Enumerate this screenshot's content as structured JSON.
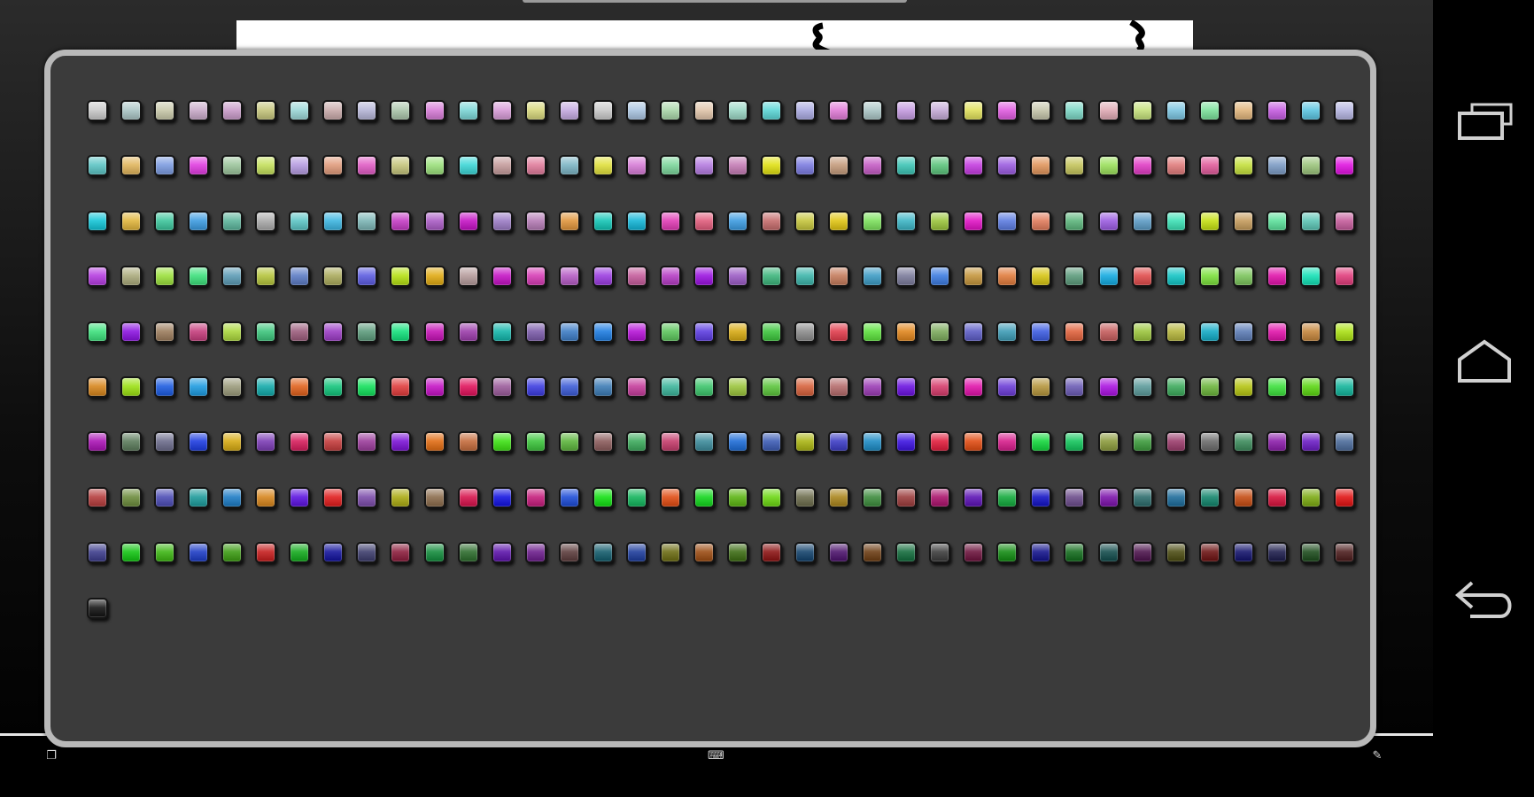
{
  "grid": {
    "columns": 38,
    "swatches": [
      "#c8c8c8",
      "#a9c4c4",
      "#c8c8a9",
      "#c8a9c8",
      "#c89ac8",
      "#c4c47a",
      "#9ad6d6",
      "#c8a9a9",
      "#b4b4d6",
      "#a9c4a9",
      "#d67ad6",
      "#7ad6d6",
      "#d69ad6",
      "#d6d67a",
      "#c4a9e0",
      "#c8c8c8",
      "#a9c4e0",
      "#a9d6a9",
      "#e0c4a9",
      "#9ad6c4",
      "#5ad6d6",
      "#a9a9e0",
      "#e07ad6",
      "#a9c4c4",
      "#c49ae0",
      "#c4a9d6",
      "#e0e05a",
      "#e05ae0",
      "#c4c4a9",
      "#7ad6c4",
      "#e0a9b4",
      "#c4e07a",
      "#7ac4e0",
      "#7ae09a",
      "#e0b47a",
      "#c45ae0",
      "#5ac4e0",
      "#b4b4e0",
      "#5ac4c4",
      "#e0b45a",
      "#7a9ae0",
      "#e03ae0",
      "#9ac49a",
      "#c4e05a",
      "#b49ae0",
      "#e09a7a",
      "#e05ac4",
      "#c4c47a",
      "#9ae07a",
      "#3ad6d6",
      "#c49a9a",
      "#e07a9a",
      "#7ab4c4",
      "#e0e03a",
      "#d67ad6",
      "#7ad69a",
      "#b47ae0",
      "#c47ab4",
      "#e0e010",
      "#7a7ae0",
      "#c49a7a",
      "#c45ac4",
      "#3ac4b4",
      "#5ac47a",
      "#c43ae0",
      "#9a5ae0",
      "#e0945a",
      "#c4c45a",
      "#9ae05a",
      "#e03ac4",
      "#e07a7a",
      "#e05a9a",
      "#c4e03a",
      "#7a9ac4",
      "#9ac47a",
      "#e010e0",
      "#10c4d6",
      "#e0b43a",
      "#3ac49a",
      "#3a9ae0",
      "#5ab49a",
      "#a9a9a9",
      "#5ac4c4",
      "#3ab4e0",
      "#7ab4b4",
      "#c43ac4",
      "#a95ac4",
      "#c410c4",
      "#9a7ac4",
      "#b47ab4",
      "#e0943a",
      "#10c4b4",
      "#10b4d6",
      "#e03ab4",
      "#e05a7a",
      "#3a9ae0",
      "#c46a6a",
      "#c4c43a",
      "#e0c410",
      "#7ae05a",
      "#3ab4c4",
      "#9ac43a",
      "#e010c4",
      "#5a7ae0",
      "#e07a5a",
      "#5ab47a",
      "#9a5ae0",
      "#5a9ac4",
      "#3ae0b4",
      "#c4e010",
      "#c49a5a",
      "#5ae09a",
      "#5ac4b4",
      "#c45a9a",
      "#b43ae0",
      "#a9a97a",
      "#9ae03a",
      "#3ae07a",
      "#5a9ab4",
      "#b4c43a",
      "#5a7ac4",
      "#a9a95a",
      "#5a5ae0",
      "#b4e010",
      "#e0a910",
      "#b49a9a",
      "#c410c4",
      "#d63ab4",
      "#b45ac4",
      "#9a3ae0",
      "#c45a9a",
      "#b43ac4",
      "#9a10e0",
      "#9a5ac4",
      "#3ab47a",
      "#3ab4a9",
      "#c47a5a",
      "#3a9ac4",
      "#7a7a9a",
      "#3a7ae0",
      "#c4943a",
      "#e07a3a",
      "#d6c410",
      "#5a9a7a",
      "#10a9e0",
      "#e04a4a",
      "#10c4c4",
      "#7ae03a",
      "#7ac45a",
      "#e010a9",
      "#10e0b4",
      "#e03a7a",
      "#3ae07a",
      "#8a10e0",
      "#9a7a5a",
      "#c43a7a",
      "#a9d63a",
      "#3ac47a",
      "#9a5a7a",
      "#9a3ac4",
      "#5a9a7a",
      "#10e07a",
      "#c410b4",
      "#9a3aa9",
      "#10b4a9",
      "#7a5aa9",
      "#3a7ac4",
      "#1a7ae0",
      "#b410d6",
      "#5ac45a",
      "#5a3ae0",
      "#d6a910",
      "#3ac43a",
      "#8a8a8a",
      "#e03a4a",
      "#5ae03a",
      "#e0841a",
      "#7aa95a",
      "#5a5ac4",
      "#3a9ab4",
      "#3a5ae0",
      "#e0603a",
      "#c45a5a",
      "#9ac43a",
      "#b4b43a",
      "#10a9c4",
      "#5a7ab4",
      "#e010a9",
      "#c4843a",
      "#a9e010",
      "#d6841a",
      "#9ae010",
      "#1a5ae0",
      "#1a9ae0",
      "#9a9a7a",
      "#10a9a9",
      "#e0601a",
      "#10c47a",
      "#10e05a",
      "#e03a3a",
      "#c410c4",
      "#e0105a",
      "#9a5a9a",
      "#3a3ae0",
      "#3a5ad6",
      "#3a7ab4",
      "#c43a9a",
      "#3ab49a",
      "#3ac46a",
      "#9ac43a",
      "#5ac43a",
      "#d6603a",
      "#b46a6a",
      "#9a3ab4",
      "#6a10e0",
      "#d63a6a",
      "#e010a9",
      "#6a3ad6",
      "#b4943a",
      "#6a5ab4",
      "#a910e0",
      "#5a9a9a",
      "#3aa95a",
      "#6ab43a",
      "#b4c410",
      "#3ae03a",
      "#5ad610",
      "#10b49a",
      "#a910b4",
      "#5a7a5a",
      "#6a6a8a",
      "#1a3ae0",
      "#d6a910",
      "#7a3ab4",
      "#d61a5a",
      "#c43a3a",
      "#9a3a9a",
      "#7a10d6",
      "#e06a10",
      "#c46a3a",
      "#3ae010",
      "#3ac43a",
      "#5ab43a",
      "#8a5a5a",
      "#3aa95a",
      "#c43a6a",
      "#3a8a9a",
      "#1a6ad6",
      "#3a5ab4",
      "#a9b410",
      "#3a3ac4",
      "#1a8ac4",
      "#3a10e0",
      "#e01a3a",
      "#e04a10",
      "#d61a8a",
      "#10d63a",
      "#10c45a",
      "#8a9a3a",
      "#3a9a3a",
      "#9a3a6a",
      "#6a6a6a",
      "#3a8a5a",
      "#8a1aa9",
      "#6a1ac4",
      "#4a6a9a",
      "#b43a3a",
      "#6a8a3a",
      "#4a4ab4",
      "#1a9a9a",
      "#1a7ac4",
      "#d6841a",
      "#5a10e0",
      "#e01a1a",
      "#7a4aa9",
      "#a9a910",
      "#8a6a4a",
      "#d6104a",
      "#1010e0",
      "#c41a7a",
      "#1a4ad6",
      "#10e010",
      "#10b45a",
      "#e04a10",
      "#10d61a",
      "#5ab410",
      "#6ad610",
      "#6a6a4a",
      "#a9841a",
      "#3a8a3a",
      "#9a3a3a",
      "#a9106a",
      "#5a10b4",
      "#10a93a",
      "#1010c4",
      "#6a4a8a",
      "#7a10a9",
      "#2a6a6a",
      "#1a6a9a",
      "#10846a",
      "#c44a10",
      "#d6103a",
      "#7aa910",
      "#e01010",
      "#3a3a8a",
      "#10c410",
      "#3ab410",
      "#1a3ac4",
      "#3a9a10",
      "#c41a1a",
      "#10a91a",
      "#10109a",
      "#3a3a6a",
      "#8a1a3a",
      "#108a3a",
      "#2a6a2a",
      "#5a10a9",
      "#6a1a8a",
      "#5a3a3a",
      "#105a6a",
      "#1a3a9a",
      "#6a6a10",
      "#9a4a10",
      "#3a6a10",
      "#8a1010",
      "#10406a",
      "#4a106a",
      "#6a3a10",
      "#106a3a",
      "#3a3a3a",
      "#6a103a",
      "#108a10",
      "#10108a",
      "#106a1a",
      "#104a4a",
      "#4a104a",
      "#4a4a10",
      "#6a1010",
      "#10106a",
      "#1a1a4a",
      "#1a4a1a",
      "#4a1a1a",
      "#101010"
    ]
  }
}
